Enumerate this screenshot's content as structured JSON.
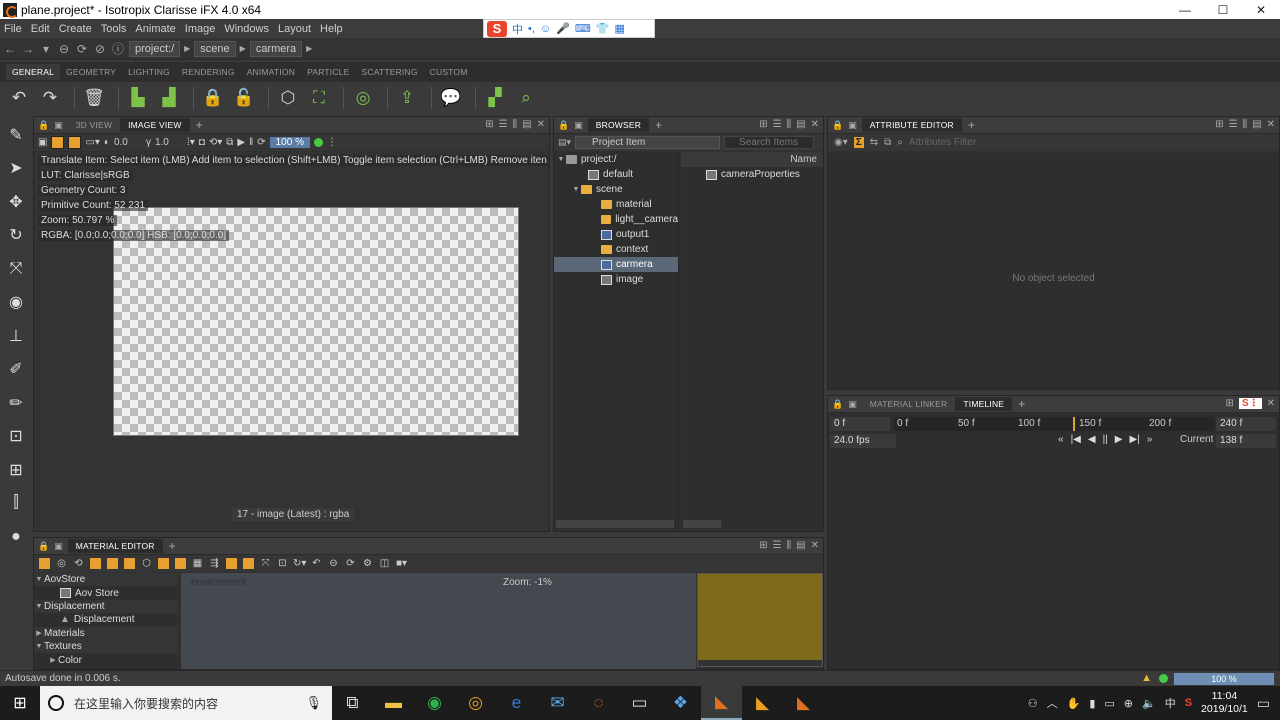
{
  "window": {
    "title": "plane.project* - Isotropix Clarisse iFX 4.0 x64",
    "minimize": "—",
    "maximize": "☐",
    "close": "✕"
  },
  "ime": {
    "logo": "S",
    "items": [
      "中",
      "•,",
      "☺",
      "🎤",
      "⌨",
      "👕",
      "▦"
    ]
  },
  "menu": [
    "File",
    "Edit",
    "Create",
    "Tools",
    "Animate",
    "Image",
    "Windows",
    "Layout",
    "Help"
  ],
  "address": {
    "crumbs": [
      "project:/",
      "scene",
      "carmera"
    ]
  },
  "shelf_tabs": [
    "GENERAL",
    "GEOMETRY",
    "LIGHTING",
    "RENDERING",
    "ANIMATION",
    "PARTICLE",
    "SCATTERING",
    "CUSTOM"
  ],
  "image_view": {
    "tabs": [
      "3D VIEW",
      "IMAGE VIEW"
    ],
    "toolbar": {
      "exposure": "0.0",
      "gamma": "1.0",
      "zoom": "100 %"
    },
    "overlay": {
      "hint": "Translate Item: Select item (LMB)  Add item to selection (Shift+LMB)  Toggle item selection (Ctrl+LMB)  Remove iten",
      "lut": "LUT: Clarisse|sRGB",
      "geometry_count": "Geometry Count: 3",
      "primitive_count": "Primitive Count: 52 231",
      "zoom": "Zoom: 50.797 %",
      "rgba": "RGBA: [0.0;0.0;0.0;0.0] HSB: [0.0;0.0;0.0]"
    },
    "status": "17 - image (Latest) : rgba"
  },
  "browser": {
    "tab": "BROWSER",
    "combo": "Project Item",
    "search_placeholder": "Search Items",
    "tree": [
      {
        "label": "project:/",
        "depth": 0,
        "icon": "folder-gray"
      },
      {
        "label": "default",
        "depth": 1,
        "icon": "lock"
      },
      {
        "label": "scene",
        "depth": 1,
        "icon": "folder"
      },
      {
        "label": "material",
        "depth": 2,
        "icon": "folder"
      },
      {
        "label": "light__camera",
        "depth": 2,
        "icon": "folder"
      },
      {
        "label": "output1",
        "depth": 2,
        "icon": "item"
      },
      {
        "label": "context",
        "depth": 2,
        "icon": "folder"
      },
      {
        "label": "carmera",
        "depth": 2,
        "icon": "item",
        "selected": true
      },
      {
        "label": "image",
        "depth": 2,
        "icon": "image"
      }
    ],
    "list_header": "Name",
    "list_items": [
      "cameraProperties"
    ]
  },
  "attribute_editor": {
    "tab": "ATTRIBUTE EDITOR",
    "filter_placeholder": "Attributes Filter",
    "empty": "No object selected"
  },
  "timeline": {
    "tabs": [
      "MATERIAL LINKER",
      "TIMELINE"
    ],
    "start": "0 f",
    "end": "240 f",
    "fps": "24.0 fps",
    "ticks": [
      "0 f",
      "50 f",
      "100 f",
      "150 f",
      "200 f"
    ],
    "current_label": "Current",
    "current": "138 f",
    "controls": [
      "«",
      "|◀",
      "◀",
      "||",
      "▶",
      "▶|",
      "»"
    ]
  },
  "material_editor": {
    "tab": "MATERIAL EDITOR",
    "tree": [
      {
        "label": "AovStore",
        "type": "cat",
        "open": true
      },
      {
        "label": "Aov Store",
        "type": "sub"
      },
      {
        "label": "Displacement",
        "type": "cat",
        "open": true
      },
      {
        "label": "Displacement",
        "type": "sub"
      },
      {
        "label": "Materials",
        "type": "cat",
        "open": false
      },
      {
        "label": "Textures",
        "type": "cat",
        "open": true
      },
      {
        "label": "Color",
        "type": "sub2"
      }
    ],
    "graph_label": "environment",
    "zoom": "Zoom: -1%"
  },
  "statusbar": {
    "message": "Autosave done in 0.006 s.",
    "progress": "100 %"
  },
  "taskbar": {
    "search_placeholder": "在这里输入你要搜索的内容",
    "time": "11:04",
    "date": "2019/10/1",
    "ime": "中"
  },
  "colors": {
    "accent": "#e8a030",
    "selection": "#5a6878",
    "preview": "#7d6a1a"
  }
}
